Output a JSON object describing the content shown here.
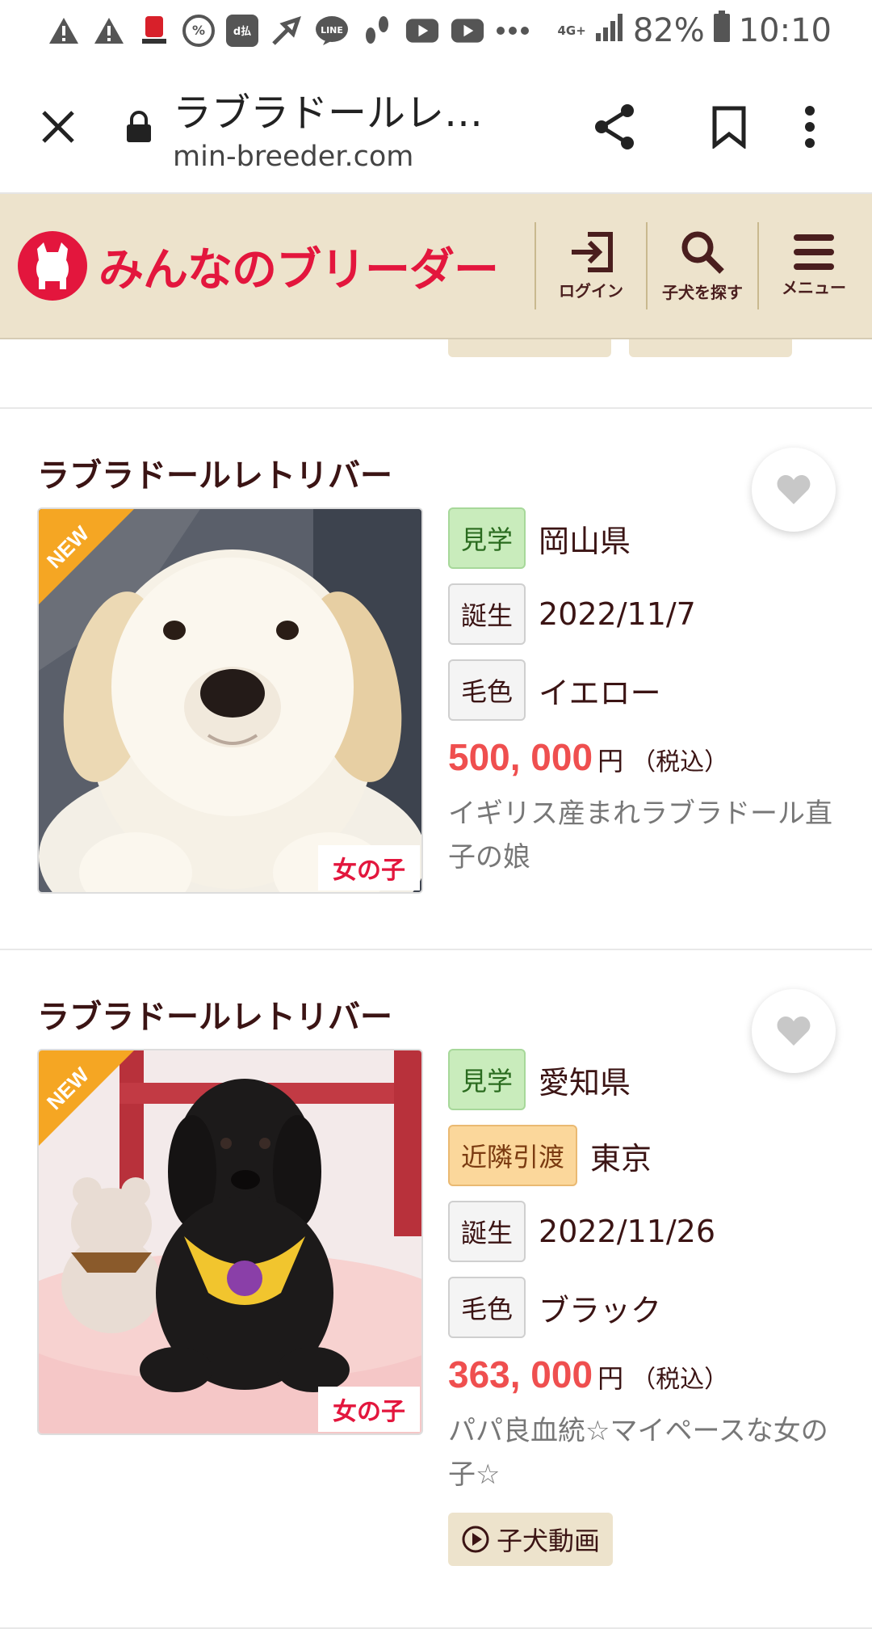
{
  "status_bar": {
    "icons": [
      "warning-icon",
      "warning-icon",
      "maruhan-app-icon",
      "percent-icon",
      "d-pay-icon",
      "share-app-icon",
      "line-icon",
      "footsteps-icon",
      "youtube-icon",
      "youtube-icon",
      "more-dots-icon"
    ],
    "network": "4G+",
    "battery": "82%",
    "time": "10:10"
  },
  "browser": {
    "title": "ラブラドールレ…",
    "url": "min-breeder.com"
  },
  "site": {
    "logo_text": "みんなのブリーダー",
    "nav": [
      {
        "label": "ログイン"
      },
      {
        "label": "子犬を探す"
      },
      {
        "label": "メニュー"
      }
    ],
    "brand_color": "#e3163d",
    "header_bg": "#ede3cc"
  },
  "listings": [
    {
      "breed": "ラブラドールレトリバー",
      "ribbon": "NEW",
      "gender": "女の子",
      "rows": [
        {
          "tag": "見学",
          "tag_style": "green",
          "value": "岡山県"
        },
        {
          "tag": "誕生",
          "tag_style": "gray",
          "value": "2022/11/7"
        },
        {
          "tag": "毛色",
          "tag_style": "gray",
          "value": "イエロー"
        }
      ],
      "price": "500, 000",
      "price_unit": "円",
      "price_tax": "（税込）",
      "description": "イギリス産まれラブラドール直子の娘"
    },
    {
      "breed": "ラブラドールレトリバー",
      "ribbon": "NEW",
      "gender": "女の子",
      "rows": [
        {
          "tag": "見学",
          "tag_style": "green",
          "value": "愛知県"
        },
        {
          "tag": "近隣引渡",
          "tag_style": "orange",
          "value": "東京"
        },
        {
          "tag": "誕生",
          "tag_style": "gray",
          "value": "2022/11/26"
        },
        {
          "tag": "毛色",
          "tag_style": "gray",
          "value": "ブラック"
        }
      ],
      "price": "363, 000",
      "price_unit": "円",
      "price_tax": "（税込）",
      "description": "パパ良血統☆マイペースな女の子☆",
      "video_label": "子犬動画"
    }
  ]
}
